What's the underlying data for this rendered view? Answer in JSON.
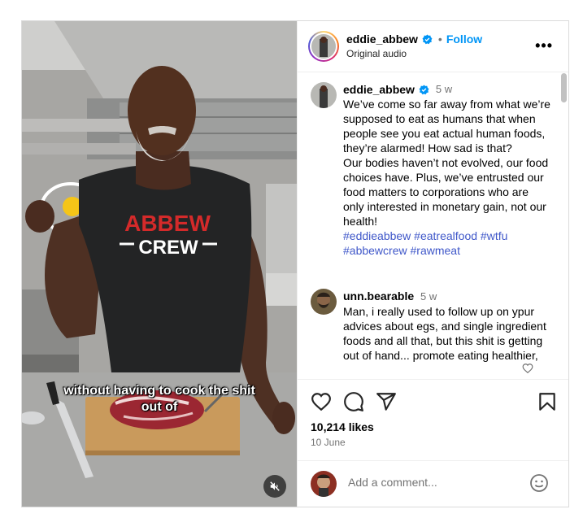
{
  "video": {
    "caption_line1": "without having to cook the shit",
    "caption_line2": "out of",
    "shirt_line1": "ABBEW",
    "shirt_line2": "CREW",
    "mute_icon": "speaker-muted-icon"
  },
  "header": {
    "username": "eddie_abbew",
    "separator": "•",
    "follow_label": "Follow",
    "subtitle": "Original audio",
    "more_label": "•••"
  },
  "post": {
    "username": "eddie_abbew",
    "time": "5 w",
    "text": "We’ve come so far away from what we’re supposed to eat as humans that when people see you eat actual human foods, they’re alarmed! How sad is that?\nOur bodies haven’t not evolved, our food choices have. Plus, we’ve entrusted our food matters to corporations who are only interested in monetary gain, not our health!",
    "hashtags": "#eddieabbew #eatrealfood #wtfu #abbewcrew #rawmeat"
  },
  "comment": {
    "username": "unn.bearable",
    "time": "5 w",
    "text": "Man, i really used to follow up on ypur advices about egs, and single ingredient foods and all that, but this shit is getting out of hand... promote eating healthier,"
  },
  "actions": {
    "likes": "10,214 likes",
    "date": "10 June",
    "icons": [
      "heart-icon",
      "comment-icon",
      "share-icon",
      "bookmark-icon"
    ]
  },
  "add_comment": {
    "placeholder": "Add a comment..."
  },
  "colors": {
    "accent": "#0095f6",
    "hashtag": "#3f57c9",
    "shirt_red": "#d42a2a"
  }
}
